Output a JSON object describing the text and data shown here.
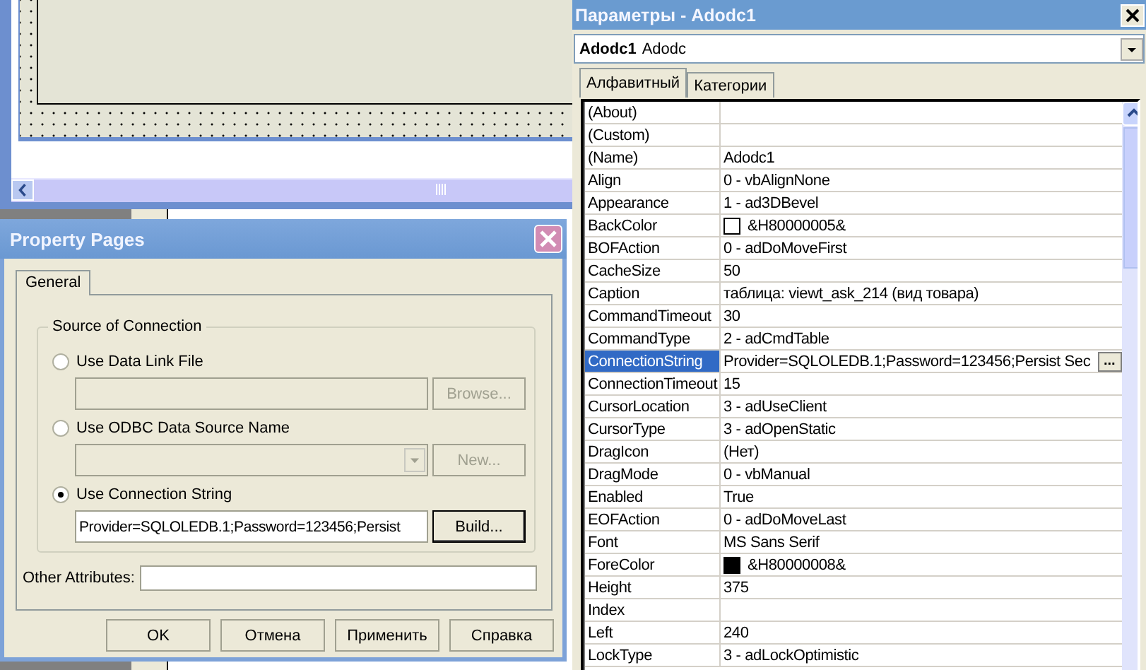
{
  "property_pages": {
    "title": "Property Pages",
    "tabs": [
      {
        "label": "General",
        "selected": true
      }
    ],
    "group_title": "Source of Connection",
    "options": [
      {
        "label": "Use Data Link File",
        "selected": false,
        "kind": "text",
        "button": "Browse...",
        "disabled": true
      },
      {
        "label": "Use ODBC Data Source Name",
        "selected": false,
        "kind": "dropdown",
        "button": "New...",
        "disabled": true
      },
      {
        "label": "Use Connection String",
        "selected": true,
        "kind": "text",
        "value": "Provider=SQLOLEDB.1;Password=123456;Persist",
        "button": "Build...",
        "disabled": false
      }
    ],
    "other_attributes": {
      "label": "Other Attributes:"
    },
    "buttons": [
      "OK",
      "Отмена",
      "Применить",
      "Справка"
    ]
  },
  "properties": {
    "title": "Параметры - Adodc1",
    "object": {
      "name": "Adodc1",
      "type": "Adodc"
    },
    "tabs": [
      {
        "label": "Алфавитный",
        "selected": true
      },
      {
        "label": "Категории",
        "selected": false
      }
    ],
    "rows": [
      {
        "name": "(About)",
        "kind": "text",
        "selected": false
      },
      {
        "name": "(Custom)",
        "kind": "text",
        "selected": false
      },
      {
        "name": "(Name)",
        "kind": "text",
        "value": "Adodc1",
        "selected": false
      },
      {
        "name": "Align",
        "kind": "text",
        "value": "0 - vbAlignNone",
        "selected": false
      },
      {
        "name": "Appearance",
        "kind": "text",
        "value": "1 - ad3DBevel",
        "selected": false
      },
      {
        "name": "BackColor",
        "kind": "color",
        "value": "&H80000005&",
        "color": "#ffffff",
        "selected": false
      },
      {
        "name": "BOFAction",
        "kind": "text",
        "value": "0 - adDoMoveFirst",
        "selected": false
      },
      {
        "name": "CacheSize",
        "kind": "text",
        "value": "50",
        "selected": false
      },
      {
        "name": "Caption",
        "kind": "text",
        "value": "таблица: viewt_ask_214 (вид товара)",
        "selected": false
      },
      {
        "name": "CommandTimeout",
        "kind": "text",
        "value": "30",
        "selected": false
      },
      {
        "name": "CommandType",
        "kind": "text",
        "value": "2 - adCmdTable",
        "selected": false
      },
      {
        "name": "ConnectionString",
        "kind": "builder",
        "value": "Provider=SQLOLEDB.1;Password=123456;Persist Sec",
        "button": "...",
        "selected": true
      },
      {
        "name": "ConnectionTimeout",
        "kind": "text",
        "value": "15",
        "selected": false
      },
      {
        "name": "CursorLocation",
        "kind": "text",
        "value": "3 - adUseClient",
        "selected": false
      },
      {
        "name": "CursorType",
        "kind": "text",
        "value": "3 - adOpenStatic",
        "selected": false
      },
      {
        "name": "DragIcon",
        "kind": "text",
        "value": "(Нет)",
        "selected": false
      },
      {
        "name": "DragMode",
        "kind": "text",
        "value": "0 - vbManual",
        "selected": false
      },
      {
        "name": "Enabled",
        "kind": "text",
        "value": "True",
        "selected": false
      },
      {
        "name": "EOFAction",
        "kind": "text",
        "value": "0 - adDoMoveLast",
        "selected": false
      },
      {
        "name": "Font",
        "kind": "text",
        "value": "MS Sans Serif",
        "selected": false
      },
      {
        "name": "ForeColor",
        "kind": "color",
        "value": "&H80000008&",
        "color": "#000000",
        "selected": false
      },
      {
        "name": "Height",
        "kind": "text",
        "value": "375",
        "selected": false
      },
      {
        "name": "Index",
        "kind": "text",
        "selected": false
      },
      {
        "name": "Left",
        "kind": "text",
        "value": "240",
        "selected": false
      },
      {
        "name": "LockType",
        "kind": "text",
        "value": "3 - adLockOptimistic",
        "selected": false
      }
    ]
  }
}
